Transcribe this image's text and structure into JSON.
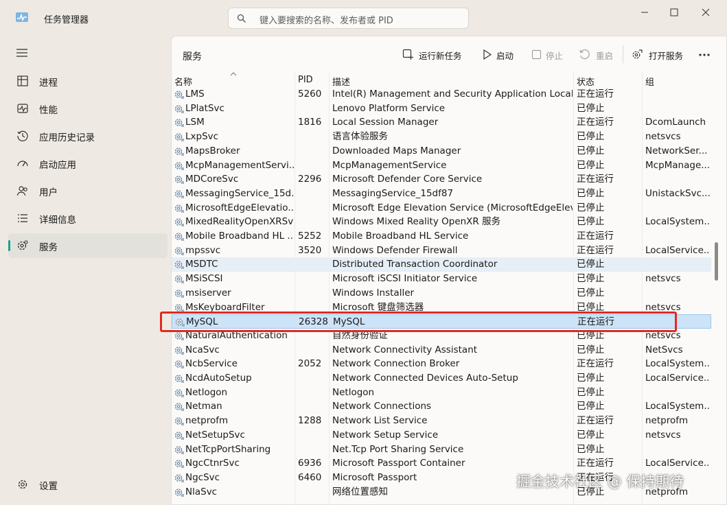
{
  "window": {
    "title": "任务管理器",
    "search_placeholder": "键入要搜索的名称、发布者或 PID"
  },
  "nav": {
    "items": [
      {
        "label": "进程",
        "icon": "processes-icon"
      },
      {
        "label": "性能",
        "icon": "performance-icon"
      },
      {
        "label": "应用历史记录",
        "icon": "app-history-icon"
      },
      {
        "label": "启动应用",
        "icon": "startup-apps-icon"
      },
      {
        "label": "用户",
        "icon": "users-icon"
      },
      {
        "label": "详细信息",
        "icon": "details-icon"
      },
      {
        "label": "服务",
        "icon": "services-icon",
        "active": true
      }
    ],
    "settings_label": "设置"
  },
  "page": {
    "title": "服务",
    "toolbar": {
      "run_new_task": "运行新任务",
      "start": "启动",
      "stop": "停止",
      "restart": "重启",
      "open_services": "打开服务"
    }
  },
  "table": {
    "columns": {
      "name": "名称",
      "pid": "PID",
      "description": "描述",
      "status": "状态",
      "group": "组"
    },
    "rows": [
      {
        "name": "LMS",
        "pid": "5260",
        "description": "Intel(R) Management and Security Application Local ...",
        "status": "正在运行",
        "group": ""
      },
      {
        "name": "LPlatSvc",
        "pid": "",
        "description": "Lenovo Platform Service",
        "status": "已停止",
        "group": ""
      },
      {
        "name": "LSM",
        "pid": "1816",
        "description": "Local Session Manager",
        "status": "正在运行",
        "group": "DcomLaunch"
      },
      {
        "name": "LxpSvc",
        "pid": "",
        "description": "语言体验服务",
        "status": "已停止",
        "group": "netsvcs"
      },
      {
        "name": "MapsBroker",
        "pid": "",
        "description": "Downloaded Maps Manager",
        "status": "已停止",
        "group": "NetworkSer..."
      },
      {
        "name": "McpManagementServi...",
        "pid": "",
        "description": "McpManagementService",
        "status": "已停止",
        "group": "McpManage..."
      },
      {
        "name": "MDCoreSvc",
        "pid": "2296",
        "description": "Microsoft Defender Core Service",
        "status": "正在运行",
        "group": ""
      },
      {
        "name": "MessagingService_15d...",
        "pid": "",
        "description": "MessagingService_15df87",
        "status": "已停止",
        "group": "UnistackSvc..."
      },
      {
        "name": "MicrosoftEdgeElevatio...",
        "pid": "",
        "description": "Microsoft Edge Elevation Service (MicrosoftEdgeElev...",
        "status": "已停止",
        "group": ""
      },
      {
        "name": "MixedRealityOpenXRSvc",
        "pid": "",
        "description": "Windows Mixed Reality OpenXR 服务",
        "status": "已停止",
        "group": "LocalSystem..."
      },
      {
        "name": "Mobile Broadband HL ...",
        "pid": "5252",
        "description": "Mobile Broadband HL Service",
        "status": "正在运行",
        "group": ""
      },
      {
        "name": "mpssvc",
        "pid": "3520",
        "description": "Windows Defender Firewall",
        "status": "正在运行",
        "group": "LocalService..."
      },
      {
        "name": "MSDTC",
        "pid": "",
        "description": "Distributed Transaction Coordinator",
        "status": "已停止",
        "group": "",
        "hover": true
      },
      {
        "name": "MSiSCSI",
        "pid": "",
        "description": "Microsoft iSCSI Initiator Service",
        "status": "已停止",
        "group": "netsvcs"
      },
      {
        "name": "msiserver",
        "pid": "",
        "description": "Windows Installer",
        "status": "已停止",
        "group": ""
      },
      {
        "name": "MsKeyboardFilter",
        "pid": "",
        "description": "Microsoft 键盘筛选器",
        "status": "已停止",
        "group": "netsvcs"
      },
      {
        "name": "MySQL",
        "pid": "26328",
        "description": "MySQL",
        "status": "正在运行",
        "group": "",
        "selected": true
      },
      {
        "name": "NaturalAuthentication",
        "pid": "",
        "description": "自然身份验证",
        "status": "已停止",
        "group": "netsvcs"
      },
      {
        "name": "NcaSvc",
        "pid": "",
        "description": "Network Connectivity Assistant",
        "status": "已停止",
        "group": "NetSvcs"
      },
      {
        "name": "NcbService",
        "pid": "2052",
        "description": "Network Connection Broker",
        "status": "正在运行",
        "group": "LocalSystem..."
      },
      {
        "name": "NcdAutoSetup",
        "pid": "",
        "description": "Network Connected Devices Auto-Setup",
        "status": "已停止",
        "group": "LocalService..."
      },
      {
        "name": "Netlogon",
        "pid": "",
        "description": "Netlogon",
        "status": "已停止",
        "group": ""
      },
      {
        "name": "Netman",
        "pid": "",
        "description": "Network Connections",
        "status": "已停止",
        "group": "LocalSystem..."
      },
      {
        "name": "netprofm",
        "pid": "1288",
        "description": "Network List Service",
        "status": "正在运行",
        "group": "netprofm"
      },
      {
        "name": "NetSetupSvc",
        "pid": "",
        "description": "Network Setup Service",
        "status": "已停止",
        "group": "netsvcs"
      },
      {
        "name": "NetTcpPortSharing",
        "pid": "",
        "description": "Net.Tcp Port Sharing Service",
        "status": "已停止",
        "group": ""
      },
      {
        "name": "NgcCtnrSvc",
        "pid": "6936",
        "description": "Microsoft Passport Container",
        "status": "正在运行",
        "group": "LocalService..."
      },
      {
        "name": "NgcSvc",
        "pid": "6460",
        "description": "Microsoft Passport",
        "status": "正在运行",
        "group": ""
      },
      {
        "name": "NlaSvc",
        "pid": "",
        "description": "网络位置感知",
        "status": "已停止",
        "group": "netprofm"
      }
    ]
  },
  "watermark": "掘金技术社区 @ 保持期待",
  "colors": {
    "accent": "#1f9e8f",
    "selection": "#cde3f7",
    "highlight_box": "#e02a1f"
  }
}
